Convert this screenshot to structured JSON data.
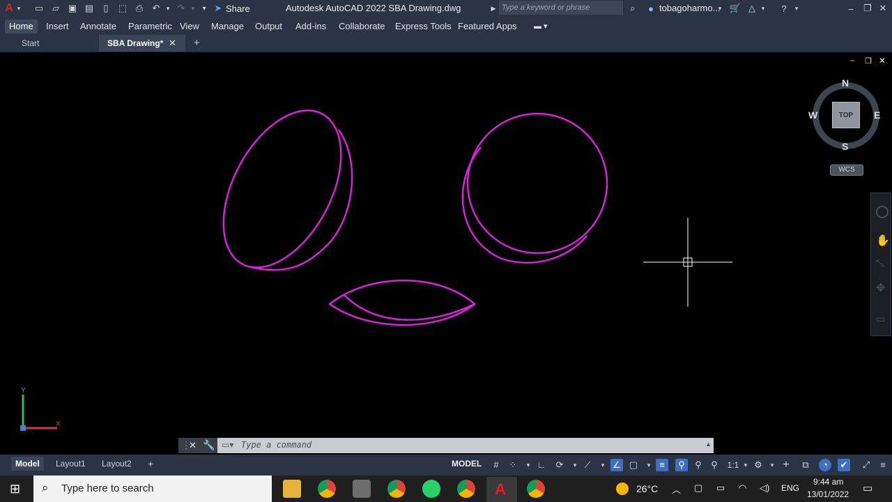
{
  "titlebar": {
    "app_title": "Autodesk AutoCAD 2022    SBA Drawing.dwg",
    "share_label": "Share",
    "search_placeholder": "Type a keyword or phrase",
    "user_name": "tobagoharmo..."
  },
  "ribbon": {
    "tabs": [
      "Home",
      "Insert",
      "Annotate",
      "Parametric",
      "View",
      "Manage",
      "Output",
      "Add-ins",
      "Collaborate",
      "Express Tools",
      "Featured Apps"
    ]
  },
  "file_tabs": {
    "start": "Start",
    "drawing": "SBA Drawing*",
    "add": "+"
  },
  "viewcube": {
    "north": "N",
    "south": "S",
    "east": "E",
    "west": "W",
    "face": "TOP",
    "wcs": "WCS"
  },
  "ucs": {
    "x": "X",
    "y": "Y"
  },
  "command": {
    "placeholder": "Type a command"
  },
  "layout_tabs": {
    "model": "Model",
    "layout1": "Layout1",
    "layout2": "Layout2",
    "add": "+"
  },
  "status": {
    "model": "MODEL",
    "scale": "1:1"
  },
  "taskbar": {
    "search_placeholder": "Type here to search",
    "temperature": "26°C",
    "language": "ENG",
    "time": "9:44 am",
    "date": "13/01/2022"
  },
  "colors": {
    "accent_magenta": "#e020e0",
    "ribbon_bg": "#2b3445",
    "canvas_bg": "#000000"
  }
}
